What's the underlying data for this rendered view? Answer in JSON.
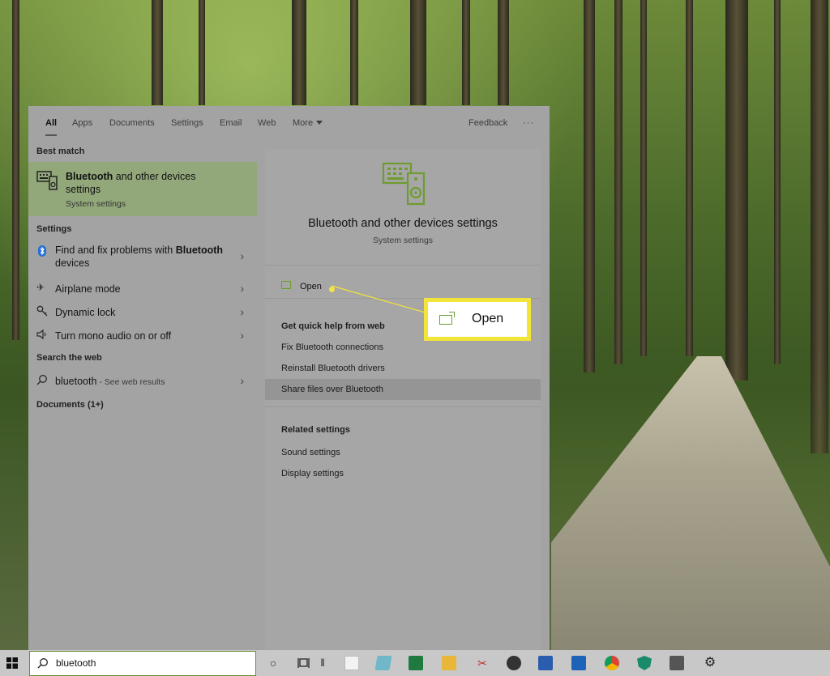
{
  "tabs": [
    {
      "label": "All",
      "active": true
    },
    {
      "label": "Apps"
    },
    {
      "label": "Documents"
    },
    {
      "label": "Settings"
    },
    {
      "label": "Email"
    },
    {
      "label": "Web"
    },
    {
      "label": "More"
    }
  ],
  "tabs_right": {
    "feedback": "Feedback",
    "more_options": "···"
  },
  "left": {
    "best_match_header": "Best match",
    "best_match": {
      "title_bold": "Bluetooth",
      "title_rest": " and other devices settings",
      "subtitle": "System settings",
      "icon": "devices-icon"
    },
    "settings_header": "Settings",
    "settings_items": [
      {
        "label_pre": "Find and fix problems with ",
        "label_bold": "Bluetooth",
        "label_post": " devices",
        "icon": "bluetooth-icon"
      },
      {
        "label": "Airplane mode",
        "icon": "airplane-icon"
      },
      {
        "label": "Dynamic lock",
        "icon": "key-icon"
      },
      {
        "label": "Turn mono audio on or off",
        "icon": "speaker-icon"
      }
    ],
    "web_header": "Search the web",
    "web_item": {
      "query": "bluetooth",
      "suffix": " - See web results"
    },
    "documents_header": "Documents (1+)"
  },
  "right": {
    "title": "Bluetooth and other devices settings",
    "subtitle": "System settings",
    "open_label": "Open",
    "help_header": "Get quick help from web",
    "help_links": [
      "Fix Bluetooth connections",
      "Reinstall Bluetooth drivers",
      "Share files over Bluetooth"
    ],
    "related_header": "Related settings",
    "related_links": [
      "Sound settings",
      "Display settings"
    ]
  },
  "callout": {
    "label": "Open",
    "color": "#f3e43a"
  },
  "taskbar": {
    "search_value": "bluetooth",
    "apps": [
      "cortana-icon",
      "task-view-icon",
      "amazon-icon",
      "notepad-icon",
      "excel-icon",
      "file-explorer-icon",
      "snipping-icon",
      "photos-icon",
      "word-icon",
      "outlook-icon",
      "chrome-icon",
      "defender-icon",
      "calculator-icon",
      "settings-icon"
    ]
  },
  "colors": {
    "accent": "#6e9c2e",
    "selection": "#93a87a",
    "panel": "#a3a3a3"
  }
}
